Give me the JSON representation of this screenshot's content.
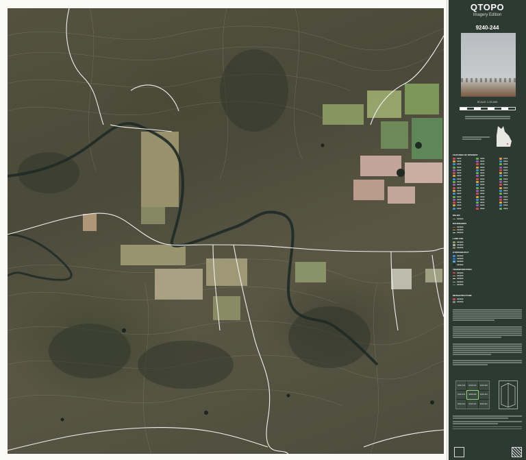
{
  "sidebar": {
    "title": "QTOPO",
    "subtitle": "Imagery Edition",
    "sheet_number": "9240-244",
    "scale": "SCALE 1:15,000",
    "legend_headings": [
      "FEATURES OF INTEREST",
      "RELIEF",
      "BOUNDARIES",
      "LAND USE",
      "HYDROGRAPHY",
      "TRANSPORTATION",
      "INFRASTRUCTURE"
    ],
    "index_sheets": [
      "9240-233",
      "9240-243",
      "9240-343",
      "9240-234",
      "9240-244",
      "9240-344",
      "9240-231",
      "9240-241",
      "9240-341"
    ]
  },
  "colors": {
    "sidebar_bg": "#2d3a33",
    "road": "#f2f2f2",
    "creek": "#1f2a26",
    "contour": "#9a9684",
    "field_green": "#8a9a62",
    "field_pink": "#c9a9a0"
  },
  "icons": [
    "queensland-locator-map",
    "cover-photo",
    "index-map",
    "fold-diagram",
    "government-logo",
    "qr-code"
  ]
}
